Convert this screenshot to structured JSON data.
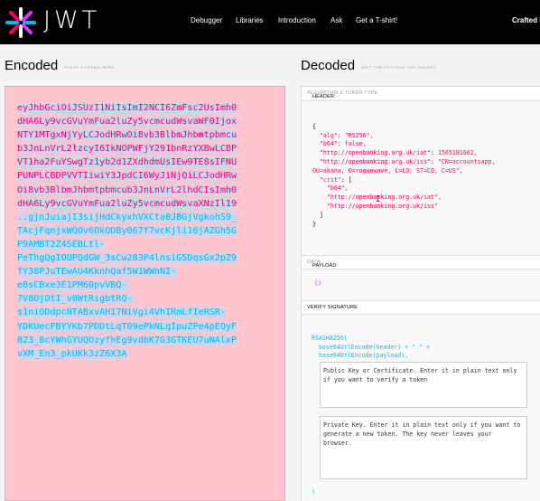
{
  "brand": "JWT",
  "nav": {
    "debugger": "Debugger",
    "libraries": "Libraries",
    "introduction": "Introduction",
    "ask": "Ask",
    "tshirt": "Get a T-shirt!",
    "crafted": "Crafted b"
  },
  "encoded": {
    "title": "Encoded",
    "subtitle": "PASTE A TOKEN HERE",
    "header_lines": [
      "eyJhbGciOiJSUzI1NiIsImI2NCI6ZmFsc2UsImh0",
      "dHA6Ly9vcGVuYmFua2luZy5vcmcudWsvaWF0Ijox",
      "NTY1MTgxNjYyLCJodHRwOi8vb3BlbmJhbmtpbmcu",
      "b3JnLnVrL2lzcyI6IkNOPWFjY291bnRzYXBwLCBP",
      "VT1ha2FuYSwgTz1yb2d1ZXdhdmUsIEw9TE8sIFNU",
      "PUNPLCBDPVVTIiwiY3JpdCI6WyJiNjQiLCJodHRw",
      "Oi8vb3BlbmJhbmtpbmcub3JnLnVrL2lhdCIsImh0",
      "dHA6Ly9vcGVuYmFua2luZy5vcmcudWsvaXNzIl19"
    ],
    "payload_line": "..",
    "signature_lines": [
      "gjnJuiajI3sijHdCkyxhVXCta0JBGjVgkohS9_",
      "TAcjFqnjxWQOv6OkQDBy067f7vcKjli16jAZGh5G",
      "P9AMBT2Z4SEBLtl-",
      "PeThgQgIOUPQdGW_3sCw283P4lnsiG5DqsGx2pZ9",
      "fY38PJuTEwAU4KknhQaf5W1WWnNI-",
      "e8sCBxe3E1PM60pvVBQ-",
      "7V8OjOtI_v0WtRigbtRQ-",
      "s1niODdpcNTABxvAH17NiVgi4VhIRmLfIeRSR-",
      "YDKUecFBYYKb7PDDtLqT09ePkNLqIpuZPe4pEQyF",
      "823_8cYWhGYUQOzyfhEg9vdbK7G3GTKEU7uNAlxP",
      "vXM_En3_pkUKk3zZ6X3A"
    ]
  },
  "decoded": {
    "title": "Decoded",
    "subtitle": "EDIT THE PAYLOAD AND SECRET",
    "header_section": {
      "label": "HEADER:",
      "sub": "ALGORITHM & TOKEN TYPE"
    },
    "header_json": {
      "open": "{",
      "alg_key": "\"alg\"",
      "alg_val": "\"RS256\",",
      "b64_key": "\"b64\"",
      "b64_val": "false,",
      "iat_key": "\"http://openbanking.org.uk/iat\"",
      "iat_val": "1565181662,",
      "iss_key": "\"http://openbanking.org.uk/iss\"",
      "iss_val": "\"CN=accountsapp,",
      "iss_cont": "OU=akana, O=roguewave, L=LO, ST=CO, C=US\",",
      "crit_key": "\"crit\"",
      "crit_open": "[",
      "crit_items": [
        "\"b64\",",
        "\"http://openbanking.org.uk/iat\",",
        "\"http://openbanking.org.uk/iss\""
      ],
      "crit_close": "]",
      "close": "}"
    },
    "payload_section": {
      "label": "PAYLOAD:",
      "sub": "DATA"
    },
    "payload_json": "{}",
    "verify_section": {
      "label": "VERIFY SIGNATURE"
    },
    "verify": {
      "fn": "RSASHA256(",
      "line2": "base64UrlEncode(header) + \".\" +",
      "line3": "base64UrlEncode(payload),",
      "public_key_placeholder": "Public Key or Certificate. Enter it in plain text only if you want to verify a token",
      "private_key_placeholder": "Private Key. Enter it in plain text only if you want to generate a new token. The key never leaves your browser.",
      "close": ")"
    }
  },
  "colors": {
    "header": "#fb015b",
    "payload": "#d63aff",
    "signature": "#00b9f1",
    "encoded_bg": "#ffc6cf"
  }
}
